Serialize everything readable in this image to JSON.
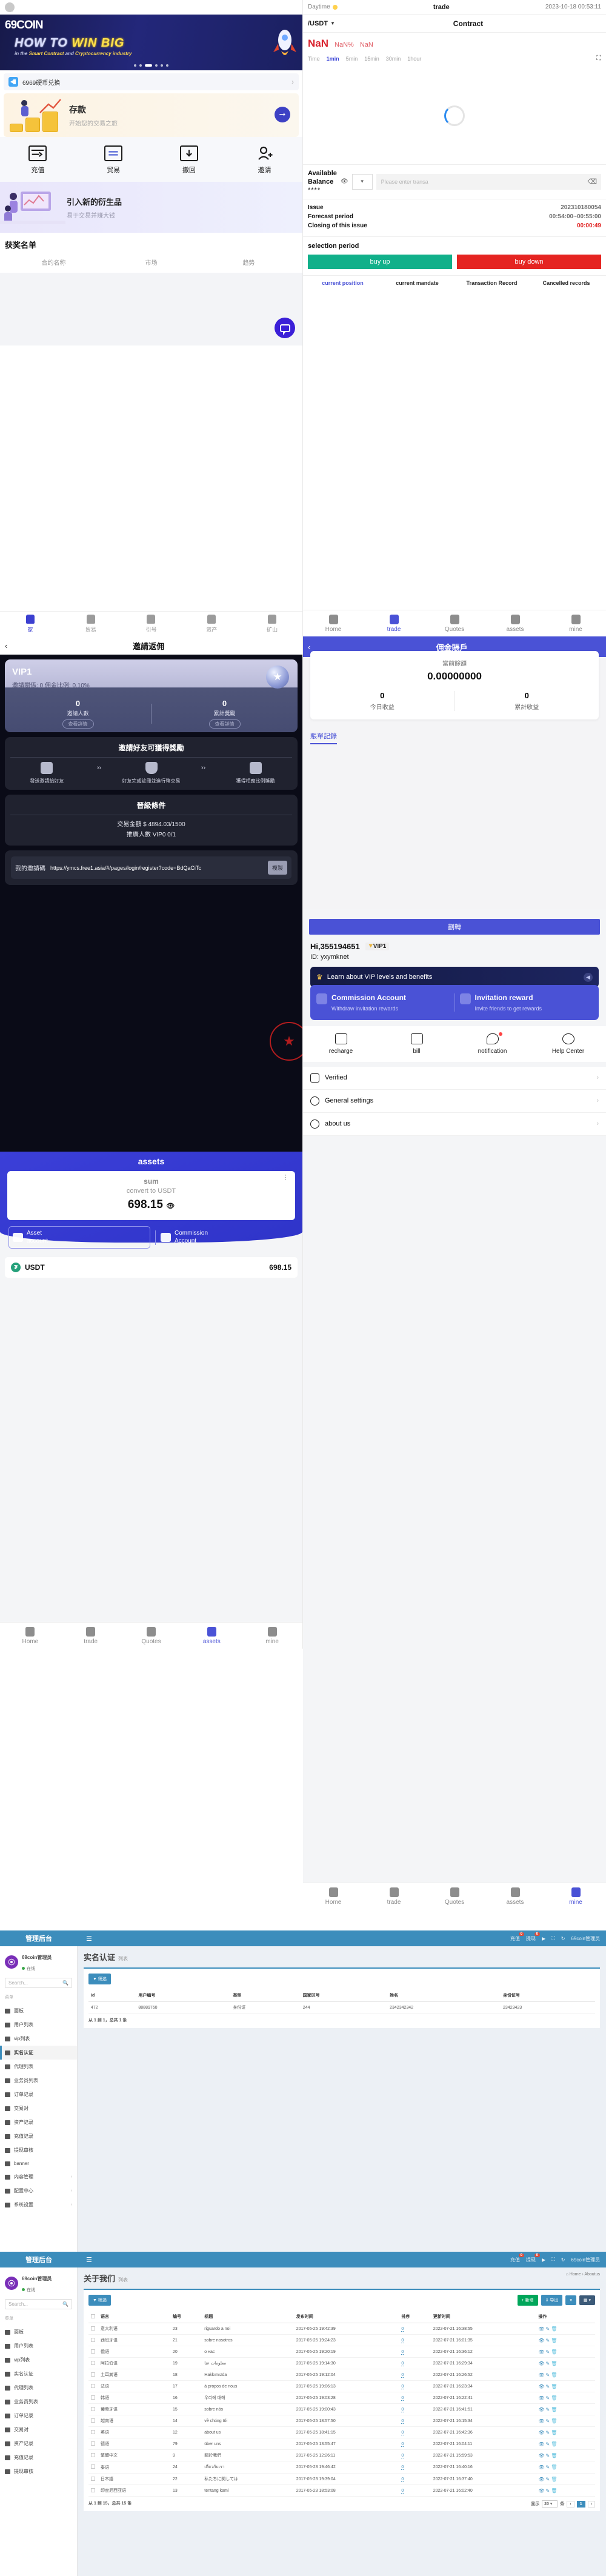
{
  "home": {
    "banner": {
      "logo": "69COIN",
      "headline_white": "HOW TO ",
      "headline_yellow": "WIN BIG",
      "sub_plain_1": "in the ",
      "sub_hi_1": "Smart Contract",
      "sub_plain_2": " and ",
      "sub_hi_2": "Cryptocurrency industry"
    },
    "notice": "6969硬币兑换",
    "deposit": {
      "title": "存款",
      "subtitle": "开始您的交易之旅"
    },
    "quick_actions": [
      {
        "label": "充值",
        "icon": "recharge-icon"
      },
      {
        "label": "贸易",
        "icon": "trade-icon"
      },
      {
        "label": "撤回",
        "icon": "withdraw-icon"
      },
      {
        "label": "邀请",
        "icon": "invite-icon"
      }
    ],
    "promo": {
      "title": "引入新的衍生品",
      "subtitle": "易于交易并赚大钱"
    },
    "winners": {
      "title": "获奖名单",
      "columns": [
        "合约名称",
        "市场",
        "趋势"
      ],
      "rows": []
    },
    "tabbar": [
      {
        "label": "家",
        "icon": "home-icon",
        "active": true
      },
      {
        "label": "贸易",
        "icon": "trade-icon",
        "active": false
      },
      {
        "label": "引号",
        "icon": "quotes-icon",
        "active": false
      },
      {
        "label": "资产",
        "icon": "assets-icon",
        "active": false
      },
      {
        "label": "矿山",
        "icon": "mine-icon",
        "active": false
      }
    ]
  },
  "trade": {
    "statusbar": {
      "daytime": "Daytime",
      "title": "trade",
      "datetime": "2023-10-18 00:53:11"
    },
    "pair": {
      "symbol": "/USDT",
      "title": "Contract"
    },
    "price": {
      "last": "NaN",
      "change_pct": "NaN%",
      "change_abs": "NaN"
    },
    "timeframes": [
      {
        "label": "Time",
        "active": false
      },
      {
        "label": "1min",
        "active": true
      },
      {
        "label": "5min",
        "active": false
      },
      {
        "label": "15min",
        "active": false
      },
      {
        "label": "30min",
        "active": false
      },
      {
        "label": "1hour",
        "active": false
      }
    ],
    "balance": {
      "label_line1": "Available",
      "label_line2": "Balance",
      "masked_value": "****"
    },
    "amount_placeholder": "Please enter transa",
    "issue": {
      "issue_label": "Issue",
      "issue_value": "202310180054",
      "forecast_label": "Forecast period",
      "forecast_value": "00:54:00~00:55:00",
      "closing_label": "Closing of this issue",
      "closing_value": "00:00:49"
    },
    "selection_period": "selection period",
    "buy_up": "buy up",
    "buy_down": "buy down",
    "record_tabs": [
      {
        "label": "current position",
        "active": true
      },
      {
        "label": "current mandate",
        "active": false
      },
      {
        "label": "Transaction Record",
        "active": false
      },
      {
        "label": "Cancelled records",
        "active": false
      }
    ],
    "navbar": [
      {
        "label": "Home",
        "active": false
      },
      {
        "label": "trade",
        "active": true
      },
      {
        "label": "Quotes",
        "active": false
      },
      {
        "label": "assets",
        "active": false
      },
      {
        "label": "mine",
        "active": false
      }
    ]
  },
  "invite": {
    "title": "邀請返佣",
    "vip": {
      "level": "VIP1",
      "detail": "邀請關係: 0  佣金比例: 0.10%"
    },
    "stats": [
      {
        "value": "0",
        "label": "邀請人數",
        "button": "查看詳情"
      },
      {
        "value": "0",
        "label": "累計獎勵",
        "button": "查看詳情"
      }
    ],
    "rewards": {
      "title": "邀請好友可獲得獎勵",
      "steps": [
        "發送邀請給好友",
        "好友完成註冊並進行幣交易",
        "獲得相應比例獎勵"
      ]
    },
    "upgrade": {
      "title": "晉級條件",
      "lines": [
        "交易金額 $ 4894.03/1500",
        "推廣人數 VIP0 0/1"
      ]
    },
    "invite_code": {
      "label": "我的邀請碼",
      "url": "https://ymcs.free1.asia/#/pages/login/register?code=BdQaCiTc",
      "copy": "複製"
    }
  },
  "commission": {
    "title": "佣金賬戶",
    "balance_label": "當前餘額",
    "balance_value": "0.00000000",
    "today": {
      "value": "0",
      "label": "今日收益"
    },
    "total": {
      "value": "0",
      "label": "累計收益"
    },
    "bill_record": "賬單記錄"
  },
  "assets": {
    "title": "assets",
    "sum_label": "sum",
    "convert_label": "convert to USDT",
    "total": "698.15",
    "accounts": [
      {
        "label_line1": "Asset",
        "label_line2": "account",
        "icon": "wallet-icon",
        "active": true
      },
      {
        "label_line1": "Commission",
        "label_line2": "Account",
        "icon": "money-bag-icon",
        "active": false
      }
    ],
    "coins": [
      {
        "name": "USDT",
        "amount": "698.15",
        "icon": "usdt-icon"
      }
    ],
    "navbar": [
      {
        "label": "Home",
        "active": false
      },
      {
        "label": "trade",
        "active": false
      },
      {
        "label": "Quotes",
        "active": false
      },
      {
        "label": "assets",
        "active": true
      },
      {
        "label": "mine",
        "active": false
      }
    ]
  },
  "mine": {
    "transfer_button": "劃轉",
    "greeting": "Hi,355194651",
    "vip_chip": "VIP1",
    "id": "ID: yxymknet",
    "vip_banner": "Learn about VIP levels and benefits",
    "cards": [
      {
        "title": "Commission Account",
        "subtitle": "Withdraw invitation rewards",
        "icon": "money-bag-icon"
      },
      {
        "title": "Invitation reward",
        "subtitle": "Invite friends to get rewards",
        "icon": "envelope-icon"
      }
    ],
    "quick": [
      {
        "label": "recharge",
        "icon": "recharge-icon",
        "badge": false
      },
      {
        "label": "bill",
        "icon": "bill-icon",
        "badge": false
      },
      {
        "label": "notification",
        "icon": "notification-icon",
        "badge": true
      },
      {
        "label": "Help Center",
        "icon": "help-icon",
        "badge": false
      }
    ],
    "menu": [
      {
        "label": "Verified",
        "icon": "id-card-icon"
      },
      {
        "label": "General settings",
        "icon": "gear-icon"
      },
      {
        "label": "about us",
        "icon": "user-circle-icon"
      }
    ],
    "navbar": [
      {
        "label": "Home",
        "active": false
      },
      {
        "label": "trade",
        "active": false
      },
      {
        "label": "Quotes",
        "active": false
      },
      {
        "label": "assets",
        "active": false
      },
      {
        "label": "mine",
        "active": true
      }
    ]
  },
  "admin": {
    "brand": "管理后台",
    "topright": [
      {
        "label": "充值",
        "badge": "0"
      },
      {
        "label": "提现",
        "badge": "0"
      }
    ],
    "account": {
      "name": "69coin管理员",
      "status": "在线"
    },
    "search_placeholder": "Search...",
    "menu_label": "菜单",
    "menu": [
      {
        "label": "面板",
        "icon": "dashboard-icon",
        "active": false,
        "caret": false
      },
      {
        "label": "用户列表",
        "icon": "users-icon",
        "active": false,
        "caret": false
      },
      {
        "label": "vip列表",
        "icon": "vip-icon",
        "active": false,
        "caret": false
      },
      {
        "label": "实名认证",
        "icon": "idcard-icon",
        "active": true,
        "caret": false
      },
      {
        "label": "代理列表",
        "icon": "agent-icon",
        "active": false,
        "caret": false
      },
      {
        "label": "业务员列表",
        "icon": "salesman-icon",
        "active": false,
        "caret": false
      },
      {
        "label": "订单记录",
        "icon": "orders-icon",
        "active": false,
        "caret": false
      },
      {
        "label": "交易对",
        "icon": "pairs-icon",
        "active": false,
        "caret": false
      },
      {
        "label": "资产记录",
        "icon": "assets-icon",
        "active": false,
        "caret": false
      },
      {
        "label": "充值记录",
        "icon": "recharge-icon",
        "active": false,
        "caret": false
      },
      {
        "label": "提现审核",
        "icon": "withdraw-icon",
        "active": false,
        "caret": false
      },
      {
        "label": "banner",
        "icon": "image-icon",
        "active": false,
        "caret": false
      },
      {
        "label": "内容管理",
        "icon": "content-icon",
        "active": false,
        "caret": true
      },
      {
        "label": "配置中心",
        "icon": "config-icon",
        "active": false,
        "caret": true
      },
      {
        "label": "系统设置",
        "icon": "settings-icon",
        "active": false,
        "caret": true
      }
    ],
    "panel1": {
      "title": "实名认证",
      "subtitle": "列表",
      "filter_button": "筛选",
      "columns": [
        "Id",
        "用户编号",
        "类型",
        "国家区号",
        "姓名",
        "身份证号"
      ],
      "rows": [
        [
          "472",
          "88889760",
          "身份证",
          "244",
          "2342342342",
          "23423423"
        ]
      ],
      "footer": "从 1 到 1，总共 1 条"
    },
    "panel2": {
      "title": "关于我们",
      "subtitle": "列表",
      "breadcrumb_home": "Home",
      "breadcrumb_page": "Aboutus",
      "filter_button": "筛选",
      "add_button": "新增",
      "export_button": "导出",
      "columns": [
        "",
        "语言",
        "编号",
        "标题",
        "发布时间",
        "排序",
        "更新时间",
        "操作"
      ],
      "rows": [
        [
          "",
          "意大利语",
          "23",
          "riguardo a noi",
          "2017-05-25 19:42:39",
          "0",
          "2022-07-21 16:38:55"
        ],
        [
          "",
          "西班牙语",
          "21",
          "sobre nosotros",
          "2017-05-25 19:24:23",
          "0",
          "2022-07-21 16:01:35"
        ],
        [
          "",
          "俄语",
          "20",
          "о нас",
          "2017-05-25 19:20:19",
          "0",
          "2022-07-21 16:36:12"
        ],
        [
          "",
          "阿拉伯语",
          "19",
          "معلومات عنا",
          "2017-05-25 19:14:30",
          "0",
          "2022-07-21 16:29:34"
        ],
        [
          "",
          "土耳其语",
          "18",
          "Hakkımızda",
          "2017-05-25 19:12:04",
          "0",
          "2022-07-21 16:26:52"
        ],
        [
          "",
          "法语",
          "17",
          "à propos de nous",
          "2017-05-25 19:06:13",
          "0",
          "2022-07-21 16:23:34"
        ],
        [
          "",
          "韩语",
          "16",
          "우리에 대해",
          "2017-05-25 19:03:28",
          "0",
          "2022-07-21 16:22:41"
        ],
        [
          "",
          "葡萄牙语",
          "15",
          "sobre nós",
          "2017-05-25 19:00:43",
          "0",
          "2022-07-21 16:41:51"
        ],
        [
          "",
          "越南语",
          "14",
          "về chúng tôi",
          "2017-05-25 18:57:50",
          "0",
          "2022-07-21 16:15:34"
        ],
        [
          "",
          "英语",
          "12",
          "about us",
          "2017-05-25 18:41:15",
          "0",
          "2022-07-21 16:42:36"
        ],
        [
          "",
          "德语",
          "79",
          "über uns",
          "2017-05-25 13:55:47",
          "0",
          "2022-07-21 16:04:11"
        ],
        [
          "",
          "繁體中文",
          "9",
          "關於我們",
          "2017-05-25 12:26:11",
          "0",
          "2022-07-21 15:59:53"
        ],
        [
          "",
          "泰语",
          "24",
          "เกี่ยวกับเรา",
          "2017-05-23 19:46:42",
          "0",
          "2022-07-21 16:40:16"
        ],
        [
          "",
          "日本語",
          "22",
          "私たちに関しては",
          "2017-05-23 19:39:04",
          "0",
          "2022-07-21 16:37:40"
        ],
        [
          "",
          "印度尼西亚语",
          "13",
          "tentang kami",
          "2017-05-23 18:53:08",
          "0",
          "2022-07-21 16:02:40"
        ]
      ],
      "footer": "从 1 到 15，总共 15 条",
      "show_label": "显示",
      "page_size": "20",
      "unit": "条",
      "page_current": "1"
    }
  }
}
